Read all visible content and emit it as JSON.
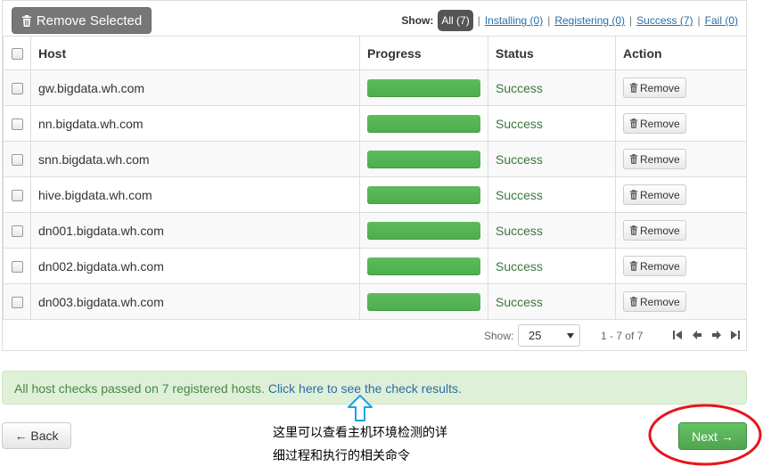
{
  "toolbar": {
    "remove_selected_label": "Remove Selected",
    "show_label": "Show:",
    "filters": [
      {
        "label": "All (7)",
        "active": true
      },
      {
        "label": "Installing (0)",
        "active": false
      },
      {
        "label": "Registering (0)",
        "active": false
      },
      {
        "label": "Success (7)",
        "active": false
      },
      {
        "label": "Fail (0)",
        "active": false
      }
    ],
    "separator": "|"
  },
  "table": {
    "columns": [
      "Host",
      "Progress",
      "Status",
      "Action"
    ],
    "rows": [
      {
        "host": "gw.bigdata.wh.com",
        "progress": 100,
        "status": "Success",
        "action": "Remove"
      },
      {
        "host": "nn.bigdata.wh.com",
        "progress": 100,
        "status": "Success",
        "action": "Remove"
      },
      {
        "host": "snn.bigdata.wh.com",
        "progress": 100,
        "status": "Success",
        "action": "Remove"
      },
      {
        "host": "hive.bigdata.wh.com",
        "progress": 100,
        "status": "Success",
        "action": "Remove"
      },
      {
        "host": "dn001.bigdata.wh.com",
        "progress": 100,
        "status": "Success",
        "action": "Remove"
      },
      {
        "host": "dn002.bigdata.wh.com",
        "progress": 100,
        "status": "Success",
        "action": "Remove"
      },
      {
        "host": "dn003.bigdata.wh.com",
        "progress": 100,
        "status": "Success",
        "action": "Remove"
      }
    ]
  },
  "pagination": {
    "show_label": "Show:",
    "page_size": "25",
    "range_text": "1 - 7 of 7"
  },
  "alert": {
    "text": "All host checks passed on 7 registered hosts. ",
    "link_text": "Click here to see the check results."
  },
  "annotation": {
    "line1": "这里可以查看主机环境检测的详",
    "line2": "细过程和执行的相关命令"
  },
  "footer": {
    "back_label": "← Back",
    "next_label": "Next →"
  },
  "colors": {
    "success_green": "#5cb85c",
    "status_text": "#3c763d",
    "link_blue": "#2a6ca8",
    "alert_bg": "#dff0d8",
    "annotation_arrow": "#1fa0e6",
    "annotation_ellipse": "#e8141c"
  },
  "icons": {
    "trash": "trash-icon",
    "first_page": "first-page-icon",
    "prev_page": "prev-page-icon",
    "next_page": "next-page-icon",
    "last_page": "last-page-icon"
  }
}
